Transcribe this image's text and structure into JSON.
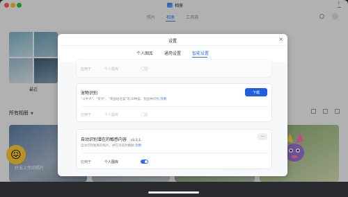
{
  "app": {
    "title": "相册",
    "help": "?"
  },
  "nav": {
    "tabs": [
      "照片",
      "相册",
      "工具箱"
    ],
    "active": 1
  },
  "sidebar": {
    "recent_label": "最近"
  },
  "albums": {
    "header": "所有相册",
    "cards": [
      {
        "label": "好友上传的照片"
      }
    ]
  },
  "modal": {
    "title": "设置",
    "close": "×",
    "tabs": [
      "个人图库",
      "通用设置",
      "智能设置"
    ],
    "active_tab": 2,
    "cards": [
      {
        "apply_label": "应用于",
        "apply_option": "个人图库",
        "toggle_on": false
      },
      {
        "title": "宠物识别",
        "description": "\"斗牛犬\"、\"柴犬\"、\"英国短毛猫\"等30种猫、狗品种识别",
        "example": "示例",
        "button": "下载",
        "apply_label": "应用于",
        "apply_option": "个人图库",
        "toggle_on": false
      },
      {
        "title": "自动识别潜在的敏感内容",
        "version": "v1.1.1",
        "description": "自动识别图库的照片，并在浏览时模糊",
        "example": "示例",
        "more": "···",
        "apply_label": "应用于",
        "apply_option": "个人图库",
        "toggle_on": true
      }
    ]
  },
  "colors": {
    "accent": "#2f6fe4",
    "window_bg": "#f6f6f7"
  }
}
